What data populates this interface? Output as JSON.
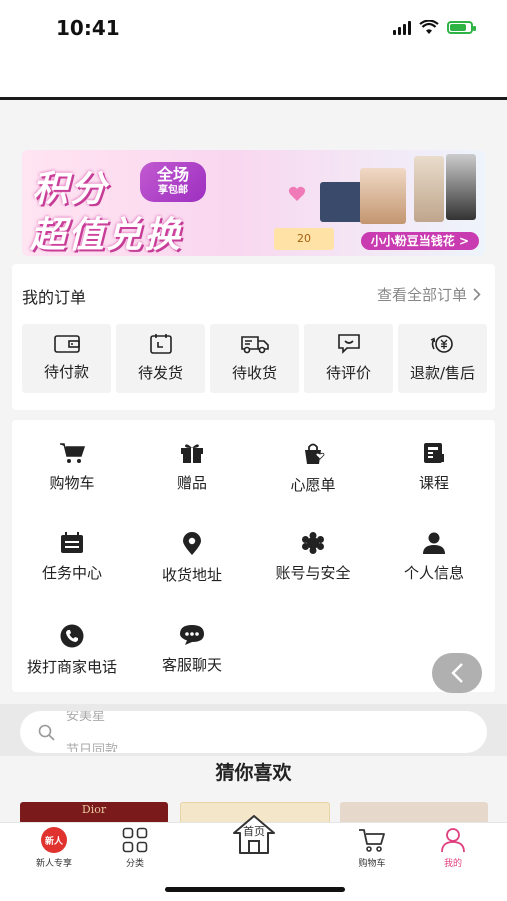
{
  "status_bar": {
    "time": "10:41"
  },
  "banner": {
    "line1": "积分",
    "line2": "超值兑换",
    "tag_line1": "全场",
    "tag_line2": "享包邮",
    "pill": "小小粉豆当钱花 >",
    "coupon": "20",
    "colors": {
      "pink": "#c93bb0",
      "purple": "#9d2fc0"
    }
  },
  "orders": {
    "title": "我的订单",
    "view_all": "查看全部订单",
    "items": [
      {
        "label": "待付款",
        "icon": "wallet-icon"
      },
      {
        "label": "待发货",
        "icon": "calendar-icon"
      },
      {
        "label": "待收货",
        "icon": "truck-icon"
      },
      {
        "label": "待评价",
        "icon": "comment-icon"
      },
      {
        "label": "退款/售后",
        "icon": "refund-icon"
      }
    ]
  },
  "services": {
    "items": [
      {
        "label": "购物车",
        "icon": "cart-icon"
      },
      {
        "label": "赠品",
        "icon": "gift-icon"
      },
      {
        "label": "心愿单",
        "icon": "wishlist-icon"
      },
      {
        "label": "课程",
        "icon": "course-icon"
      },
      {
        "label": "任务中心",
        "icon": "task-icon"
      },
      {
        "label": "收货地址",
        "icon": "location-icon"
      },
      {
        "label": "账号与安全",
        "icon": "security-icon"
      },
      {
        "label": "个人信息",
        "icon": "person-icon"
      },
      {
        "label": "拨打商家电话",
        "icon": "phone-icon"
      },
      {
        "label": "客服聊天",
        "icon": "chat-icon"
      }
    ]
  },
  "search": {
    "placeholder_top": "安美星",
    "placeholder_bottom": "节日同款"
  },
  "recommend": {
    "title": "猜你喜欢",
    "brand_text": "Dior"
  },
  "tabbar": {
    "items": [
      {
        "label": "新人专享",
        "badge": "新人"
      },
      {
        "label": "分类"
      },
      {
        "label": "首页"
      },
      {
        "label": "购物车"
      },
      {
        "label": "我的"
      }
    ],
    "active_color": "#e0407f"
  }
}
